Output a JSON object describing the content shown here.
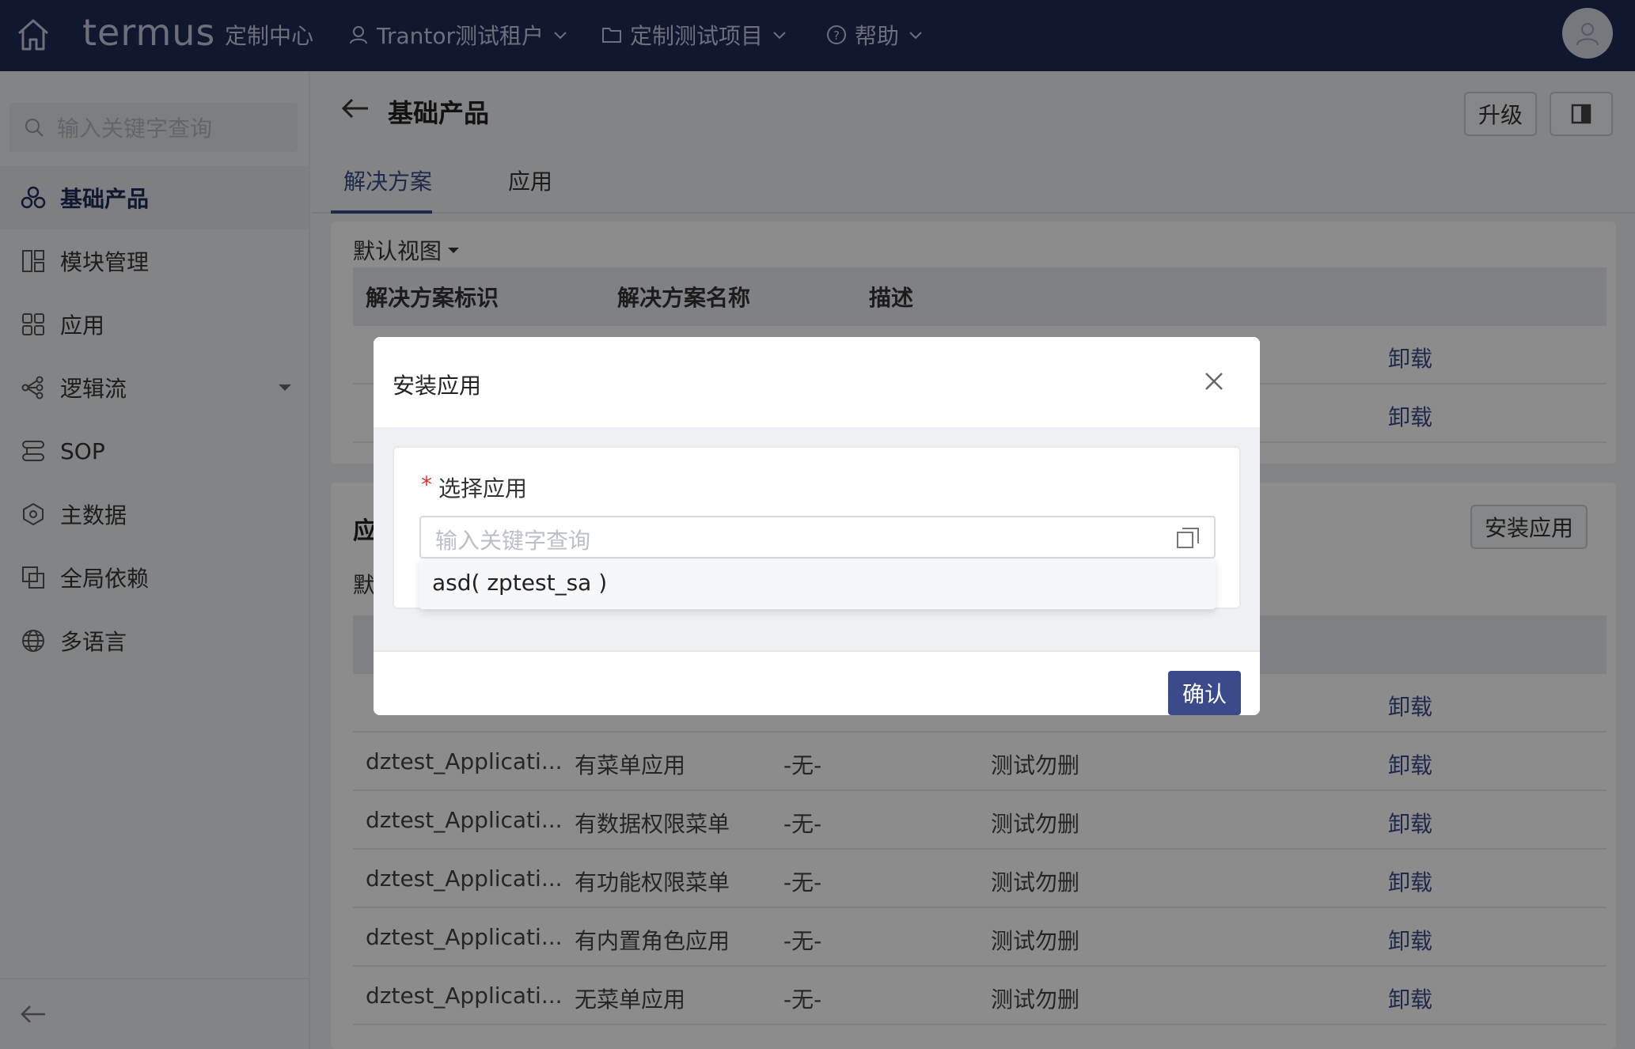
{
  "header": {
    "logo": "termus",
    "logo_sub": "定制中心",
    "tenant": "Trantor测试租户",
    "project": "定制测试项目",
    "help": "帮助"
  },
  "sidebar": {
    "search_placeholder": "输入关键字查询",
    "items": [
      {
        "label": "基础产品",
        "icon": "cube-cluster-icon",
        "active": true
      },
      {
        "label": "模块管理",
        "icon": "module-grid-icon"
      },
      {
        "label": "应用",
        "icon": "apps-grid-icon"
      },
      {
        "label": "逻辑流",
        "icon": "flow-icon",
        "expandable": true
      },
      {
        "label": "SOP",
        "icon": "sop-icon"
      },
      {
        "label": "主数据",
        "icon": "master-data-icon"
      },
      {
        "label": "全局依赖",
        "icon": "dependency-icon"
      },
      {
        "label": "多语言",
        "icon": "globe-icon"
      }
    ]
  },
  "page": {
    "title": "基础产品",
    "upgrade_btn": "升级",
    "tabs": [
      "解决方案",
      "应用"
    ],
    "view_label": "默认视图",
    "solution_table": {
      "headers": [
        "解决方案标识",
        "解决方案名称",
        "描述"
      ],
      "rows": [
        {
          "action": "卸载"
        },
        {
          "action": "卸载"
        }
      ]
    },
    "app_section": {
      "title_partial": "应",
      "view_partial": "默",
      "install_btn": "安装应用",
      "rows": [
        {
          "id": "",
          "name": "",
          "desc": "",
          "remark": "",
          "action": "卸载"
        },
        {
          "id": "dztest_Applicati...",
          "name": "有菜单应用",
          "desc": "-无-",
          "remark": "测试勿删",
          "action": "卸载"
        },
        {
          "id": "dztest_Applicati...",
          "name": "有数据权限菜单",
          "desc": "-无-",
          "remark": "测试勿删",
          "action": "卸载"
        },
        {
          "id": "dztest_Applicati...",
          "name": "有功能权限菜单",
          "desc": "-无-",
          "remark": "测试勿删",
          "action": "卸载"
        },
        {
          "id": "dztest_Applicati...",
          "name": "有内置角色应用",
          "desc": "-无-",
          "remark": "测试勿删",
          "action": "卸载"
        },
        {
          "id": "dztest_Applicati...",
          "name": "无菜单应用",
          "desc": "-无-",
          "remark": "测试勿删",
          "action": "卸载"
        }
      ]
    }
  },
  "modal": {
    "title": "安装应用",
    "field_label": "选择应用",
    "required_mark": "*",
    "search_placeholder": "输入关键字查询",
    "option": "asd( zptest_sa )",
    "confirm": "确认"
  }
}
